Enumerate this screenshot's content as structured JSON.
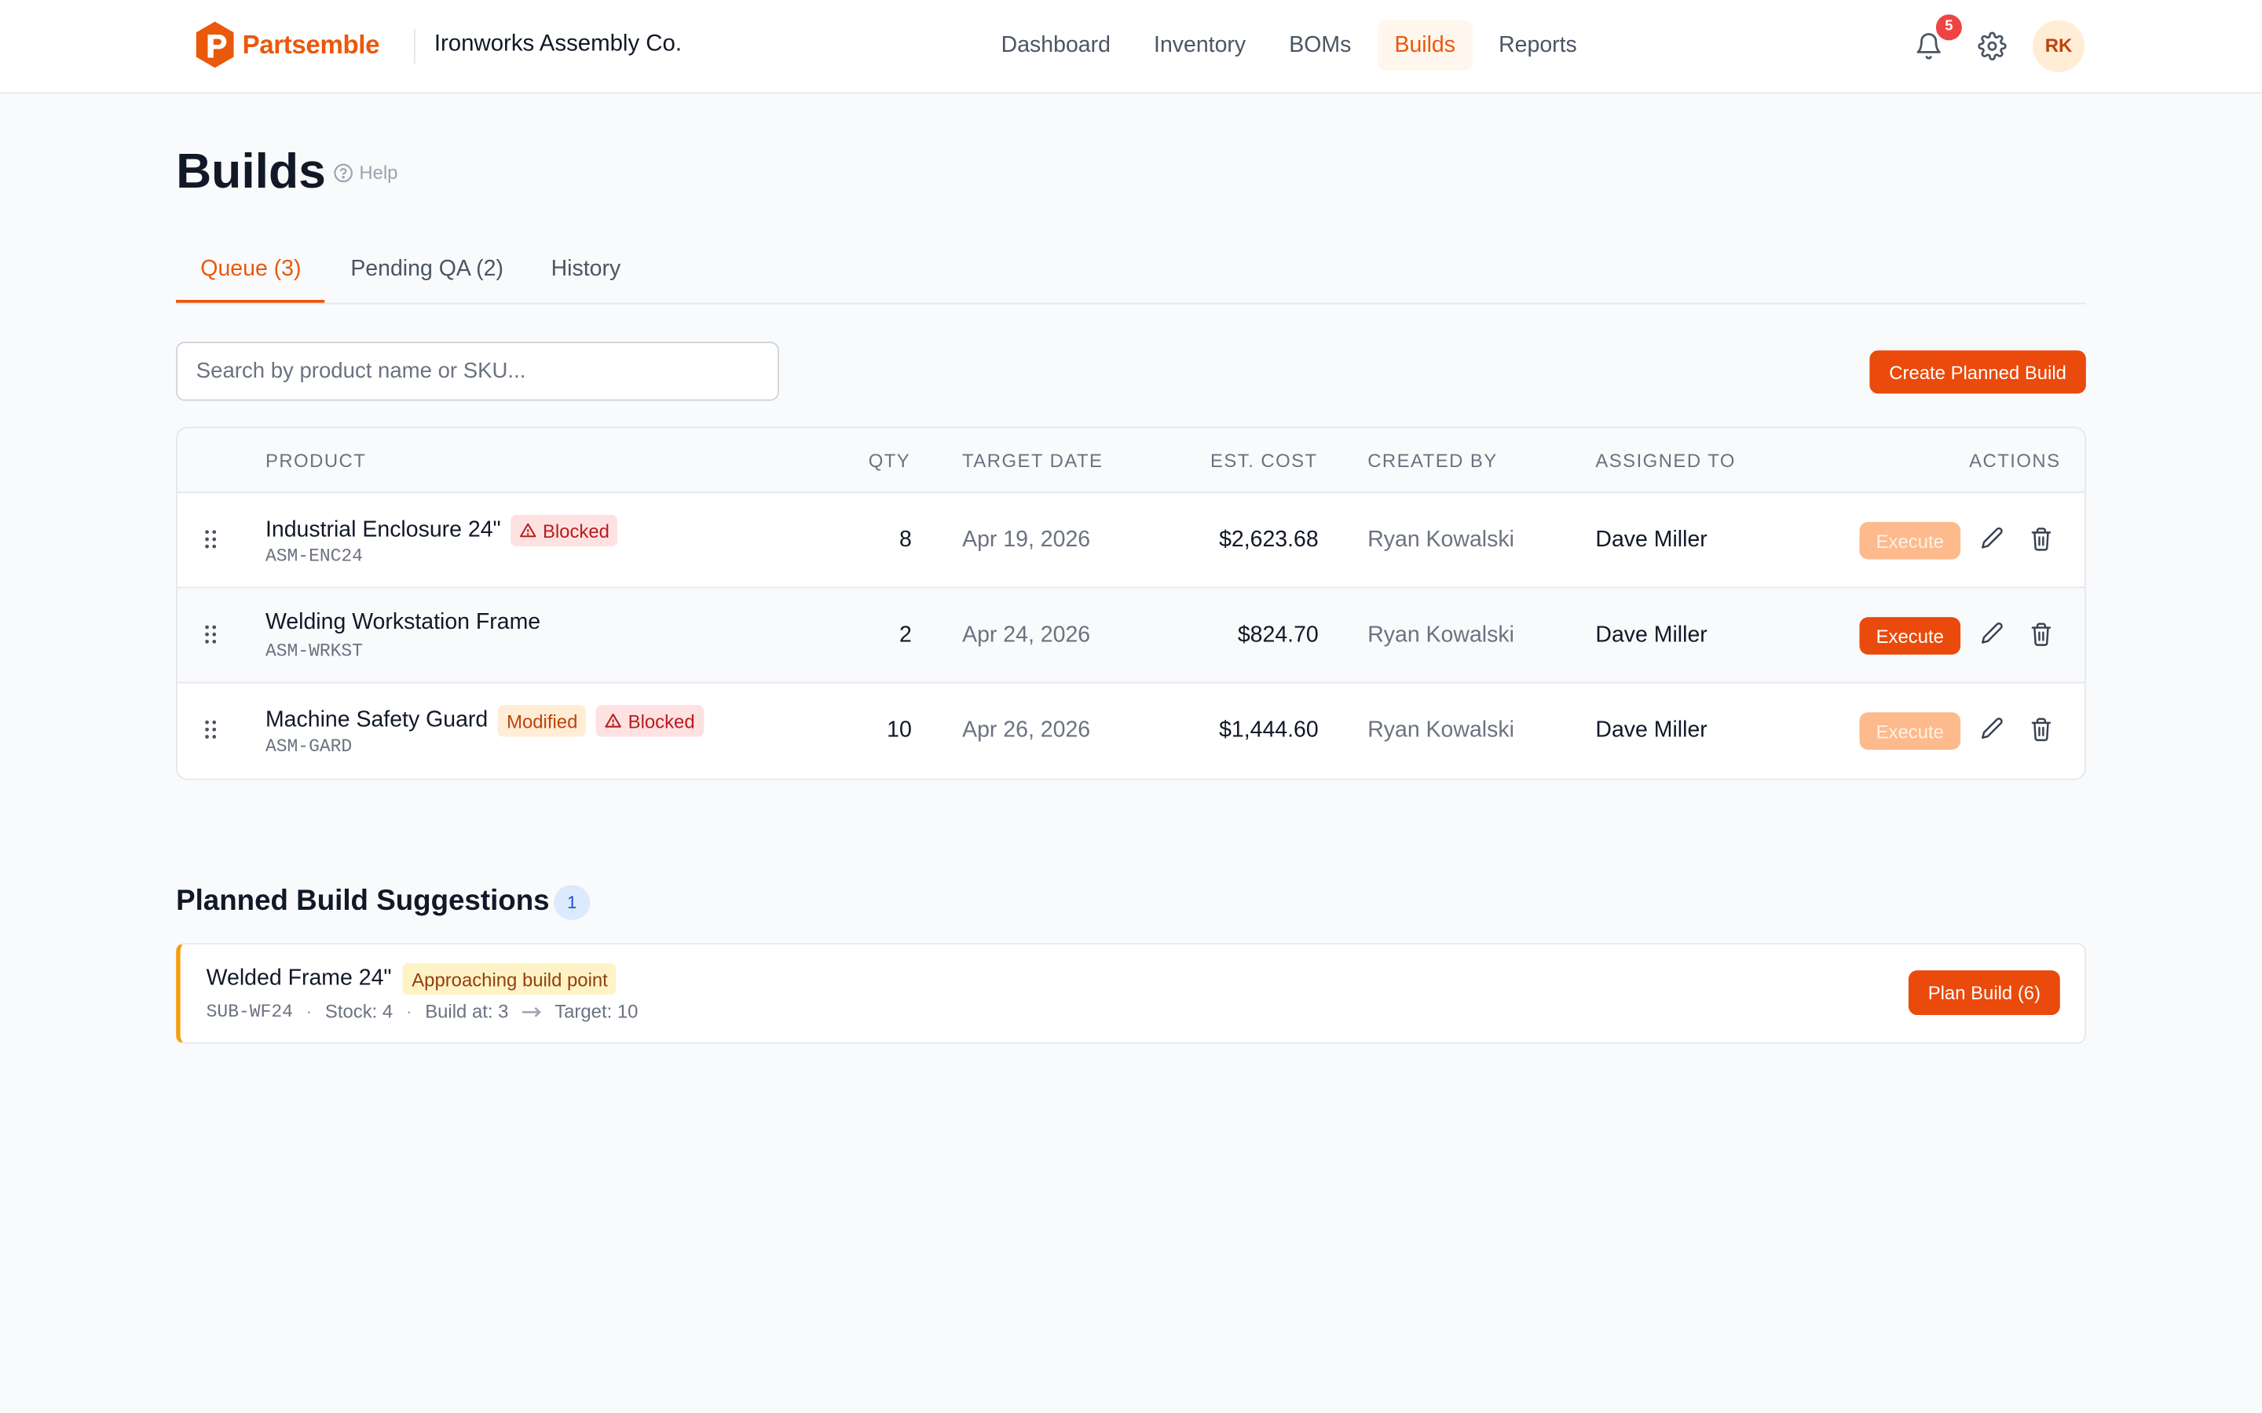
{
  "brand": {
    "name": "Partsemble",
    "org": "Ironworks Assembly Co.",
    "accent": "#ea580c"
  },
  "nav": [
    {
      "label": "Dashboard"
    },
    {
      "label": "Inventory"
    },
    {
      "label": "BOMs"
    },
    {
      "label": "Builds",
      "active": true
    },
    {
      "label": "Reports"
    }
  ],
  "header_right": {
    "notification_count": "5",
    "avatar_initials": "RK"
  },
  "page": {
    "title": "Builds",
    "help_label": "Help"
  },
  "tabs": [
    {
      "label": "Queue (3)",
      "active": true
    },
    {
      "label": "Pending QA (2)"
    },
    {
      "label": "History"
    }
  ],
  "search": {
    "placeholder": "Search by product name or SKU...",
    "value": ""
  },
  "create_button": "Create Planned Build",
  "table": {
    "columns": [
      "PRODUCT",
      "QTY",
      "TARGET DATE",
      "EST. COST",
      "CREATED BY",
      "ASSIGNED TO",
      "ACTIONS"
    ],
    "rows": [
      {
        "name": "Industrial Enclosure 24\"",
        "sku": "ASM-ENC24",
        "tags": [
          "Blocked"
        ],
        "qty": "8",
        "target_date": "Apr 19, 2026",
        "est_cost": "$2,623.68",
        "created_by": "Ryan Kowalski",
        "assigned_to": "Dave Miller",
        "execute_label": "Execute",
        "execute_enabled": false
      },
      {
        "name": "Welding Workstation Frame",
        "sku": "ASM-WRKST",
        "tags": [],
        "qty": "2",
        "target_date": "Apr 24, 2026",
        "est_cost": "$824.70",
        "created_by": "Ryan Kowalski",
        "assigned_to": "Dave Miller",
        "execute_label": "Execute",
        "execute_enabled": true
      },
      {
        "name": "Machine Safety Guard",
        "sku": "ASM-GARD",
        "tags": [
          "Modified",
          "Blocked"
        ],
        "qty": "10",
        "target_date": "Apr 26, 2026",
        "est_cost": "$1,444.60",
        "created_by": "Ryan Kowalski",
        "assigned_to": "Dave Miller",
        "execute_label": "Execute",
        "execute_enabled": false
      }
    ]
  },
  "suggestions": {
    "title": "Planned Build Suggestions",
    "count": "1",
    "items": [
      {
        "name": "Welded Frame 24\"",
        "tag": "Approaching build point",
        "sku": "SUB-WF24",
        "stock": "Stock: 4",
        "build_at": "Build at: 3",
        "target": "Target: 10",
        "button": "Plan Build (6)"
      }
    ]
  },
  "icons": [
    "logo-icon",
    "bell-icon",
    "gear-icon",
    "help-icon",
    "drag-handle-icon",
    "warning-icon",
    "edit-icon",
    "trash-icon",
    "arrow-right-icon"
  ]
}
